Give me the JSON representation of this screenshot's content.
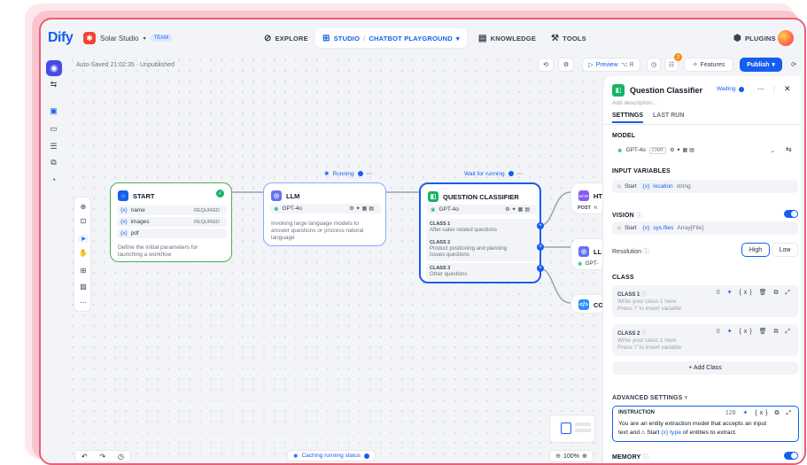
{
  "app": {
    "logo": "Dify",
    "workspace": "Solar Studio",
    "workspace_badge": "TEAM",
    "accent": "#155eef",
    "border": "#ec5d75"
  },
  "nav": {
    "explore": "EXPLORE",
    "studio": "STUDIO",
    "app_name": "CHATBOT PLAYGROUND",
    "knowledge": "KNOWLEDGE",
    "tools": "TOOLS",
    "plugins": "PLUGINS"
  },
  "toolbar": {
    "autosave": "Auto-Saved 21:02:35 · Unpublished",
    "preview": "Preview",
    "preview_shortcut": "⌥ R",
    "checklist_count": "2",
    "features": "Features",
    "publish": "Publish"
  },
  "nodes": {
    "start": {
      "title": "START",
      "vars": [
        {
          "name": "name",
          "req": "REQUIRED"
        },
        {
          "name": "images",
          "req": "REQUIRED"
        },
        {
          "name": "pdf",
          "req": ""
        }
      ],
      "desc_line1": "Define the initial parameters for",
      "desc_line2": "launching a workflow"
    },
    "llm": {
      "status": "Running",
      "title": "LLM",
      "model": "GPT-4o",
      "desc_line1": "Invoking large language models to",
      "desc_line2": "answer questions or process natural",
      "desc_line3": "language"
    },
    "classifier": {
      "status": "Wait for running",
      "title": "QUESTION CLASSIFIER",
      "model": "GPT-4o",
      "classes": [
        {
          "label": "CLASS 1",
          "line1": "After-sales related questions",
          "line2": ""
        },
        {
          "label": "CLASS 2",
          "line1": "Product positioning and planning",
          "line2": "Issues questions"
        },
        {
          "label": "CLASS 3",
          "line1": "Other questions",
          "line2": ""
        }
      ]
    },
    "http": {
      "title": "HT",
      "method": "POST",
      "url": "h"
    },
    "llm2": {
      "title": "LL",
      "model": "GPT-"
    },
    "code": {
      "title": "CO"
    }
  },
  "canvas": {
    "status": "Caching running status",
    "zoom": "100%"
  },
  "panel": {
    "title": "Question Classifier",
    "status": "Waiting",
    "desc_placeholder": "Add description...",
    "tab_settings": "SETTINGS",
    "tab_last_run": "LAST RUN",
    "model_label": "MODEL",
    "model_name": "GPT-4o",
    "model_badge": "CHAT",
    "input_label": "INPUT VARIABLES",
    "input_node": "Start",
    "input_var": "location",
    "input_type": "string",
    "vision_label": "VISION",
    "vision_node": "Start",
    "vision_var": "sys.files",
    "vision_type": "Array[File]",
    "resolution_label": "Resolution",
    "res_high": "High",
    "res_low": "Low",
    "class_label": "CLASS",
    "classes": [
      {
        "label": "CLASS 1",
        "count": "0",
        "ph1": "Write your class 1 here",
        "ph2": "Press '/' to insert variable"
      },
      {
        "label": "CLASS 2",
        "count": "0",
        "ph1": "Write your class 1 here",
        "ph2": "Press '/' to insert variable"
      }
    ],
    "add_class": "+ Add Class",
    "advanced_label": "ADVANCED SETTINGS",
    "instruction_label": "INSTRUCTION",
    "instruction_count": "128",
    "instr_line1": "You are an entity extraction model that accepts an input",
    "instr_line2a": "text and",
    "instr_node": "Start",
    "instr_var": "type",
    "instr_line2b": "of entities to extract.",
    "memory_label": "MEMORY"
  }
}
